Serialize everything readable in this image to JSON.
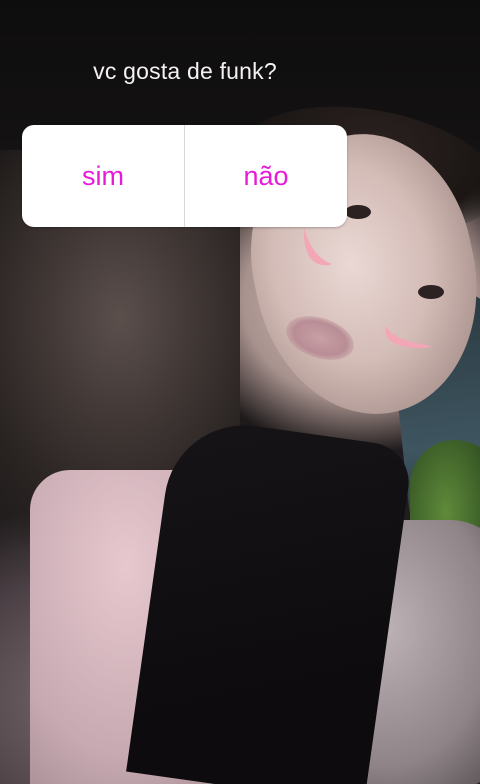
{
  "story": {
    "question": "vc gosta de funk?"
  },
  "poll": {
    "options": [
      "sim",
      "não"
    ],
    "option_color": "#e51bd8"
  },
  "colors": {
    "card_background": "#ffffff",
    "question_text": "#f5f2f2",
    "sticker_pink": "#f3a6b6"
  }
}
